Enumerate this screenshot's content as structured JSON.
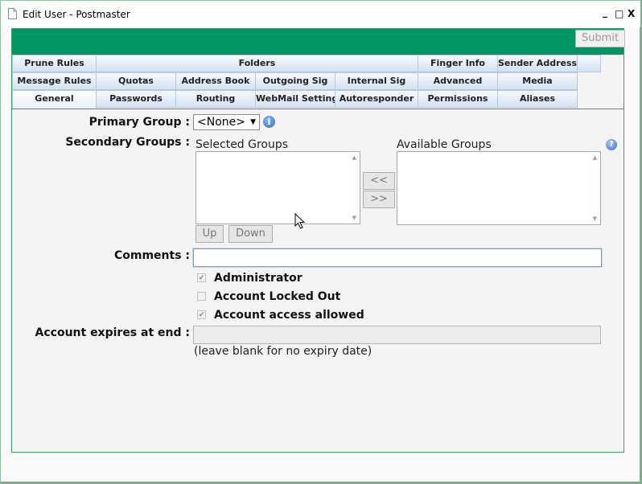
{
  "window": {
    "title": "Edit User - Postmaster",
    "minimize_glyph": "_",
    "maximize_glyph": "□",
    "close_glyph": "X",
    "icon": "document-icon"
  },
  "toolbar": {
    "submit_label": "Submit"
  },
  "colors": {
    "banner": "#009562",
    "border": "#3d9a6b"
  },
  "tabs": {
    "row1": [
      "Prune Rules",
      "Folders",
      "Finger Info",
      "Sender Address"
    ],
    "row2": [
      "Message Rules",
      "Quotas",
      "Address Book",
      "Outgoing Sig",
      "Internal Sig",
      "Advanced",
      "Media"
    ],
    "row3": [
      "General",
      "Passwords",
      "Routing",
      "WebMail Settings",
      "Autoresponder",
      "Permissions",
      "Aliases"
    ],
    "active": "General"
  },
  "form": {
    "primary_group": {
      "label": "Primary Group :",
      "value": "<None>"
    },
    "secondary_groups": {
      "label": "Secondary Groups :",
      "selected_label": "Selected Groups",
      "available_label": "Available Groups",
      "add_label": "<<",
      "remove_label": ">>",
      "up_label": "Up",
      "down_label": "Down"
    },
    "comments": {
      "label": "Comments :",
      "value": ""
    },
    "checkboxes": [
      {
        "label": "Administrator",
        "checked": true
      },
      {
        "label": "Account Locked Out",
        "checked": false
      },
      {
        "label": "Account access allowed",
        "checked": true
      }
    ],
    "expiry": {
      "label": "Account expires at end :",
      "value": "",
      "hint": "(leave blank for no expiry date)"
    }
  }
}
